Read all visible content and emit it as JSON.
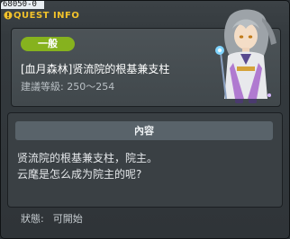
{
  "window": {
    "id_tag": "68050-0",
    "title": "QUEST INFO"
  },
  "quest": {
    "category_badge": "一般",
    "name": "[血月森林]贤流院的根基兼支柱",
    "level_label": "建議等級:",
    "level_range": "250〜254"
  },
  "content": {
    "header": "內容",
    "lines": [
      "贤流院的根基兼支柱，院主。",
      "云麾是怎么成为院主的呢?"
    ]
  },
  "status": {
    "label": "狀態:",
    "value": "可開始"
  },
  "colors": {
    "title": "#f2c22b",
    "badge": "#86b21e",
    "window_bg": "#343a3e"
  },
  "icons": {
    "title": "exclamation-icon"
  }
}
